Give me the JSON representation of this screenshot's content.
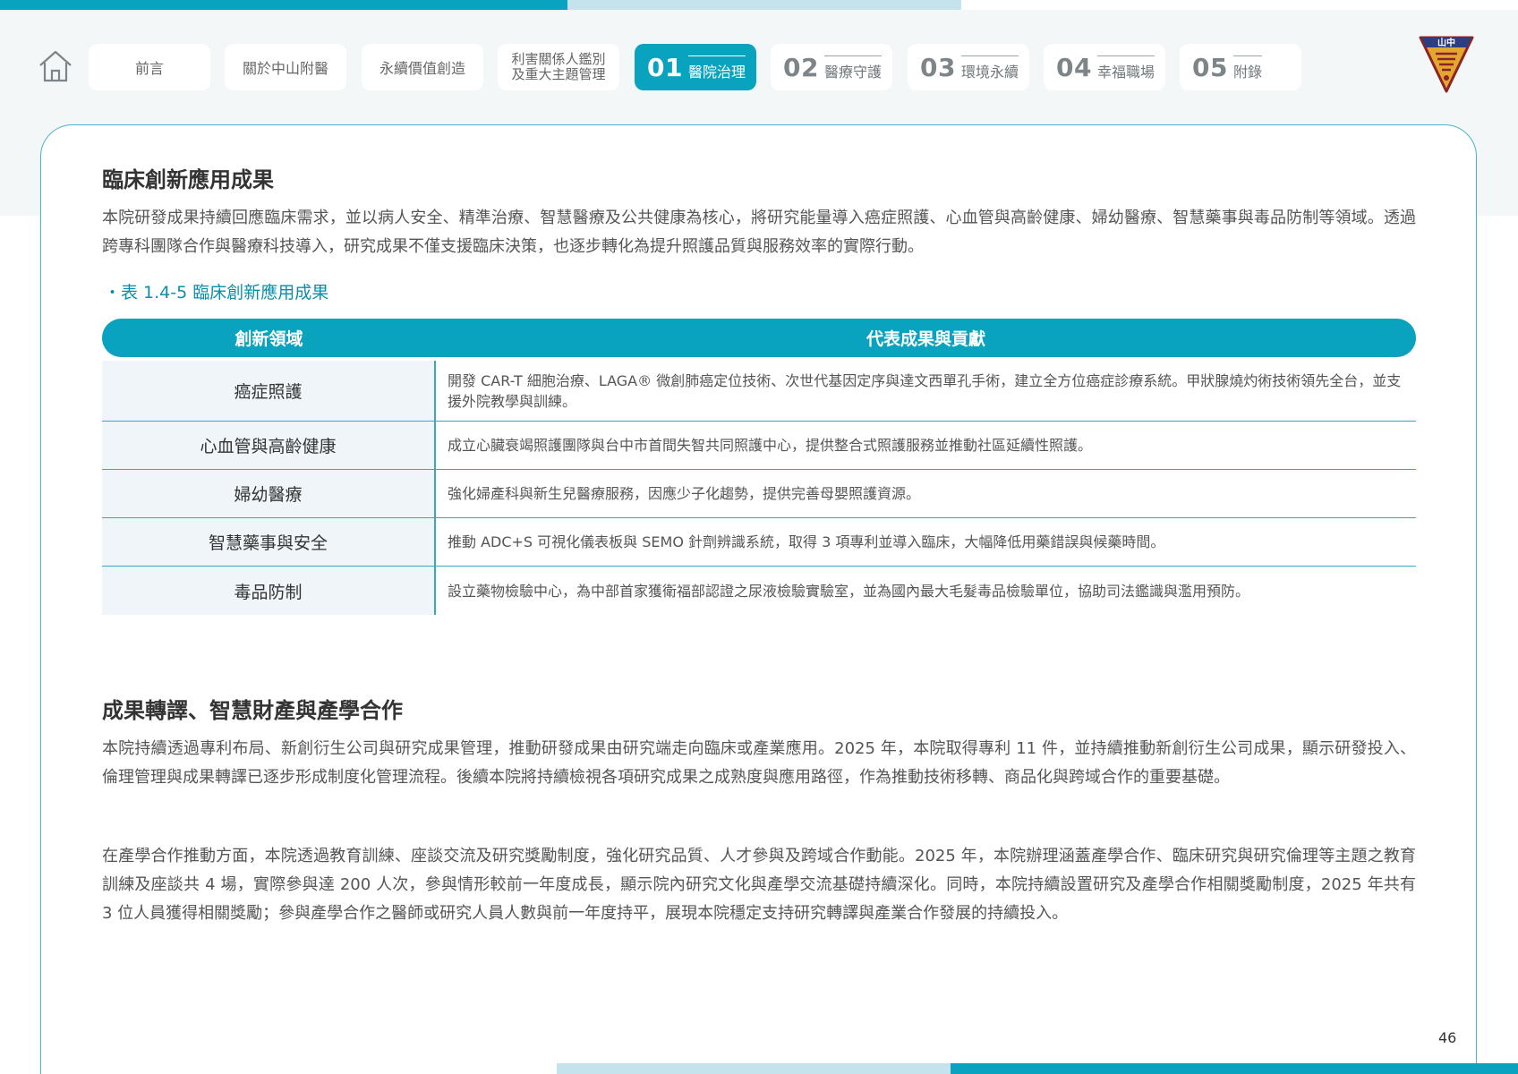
{
  "nav": {
    "tabs": [
      {
        "label": "前言"
      },
      {
        "label": "關於中山附醫"
      },
      {
        "label": "永續價值創造"
      },
      {
        "label_line1": "利害關係人鑑別",
        "label_line2": "及重大主題管理"
      }
    ],
    "chapters": [
      {
        "num": "01",
        "label": "醫院治理",
        "active": true
      },
      {
        "num": "02",
        "label": "醫療守護"
      },
      {
        "num": "03",
        "label": "環境永續"
      },
      {
        "num": "04",
        "label": "幸福職場"
      },
      {
        "num": "05",
        "label": "附錄"
      }
    ],
    "logo_text": "山中"
  },
  "section1": {
    "title": "臨床創新應用成果",
    "paragraph": "本院研發成果持續回應臨床需求，並以病人安全、精準治療、智慧醫療及公共健康為核心，將研究能量導入癌症照護、心血管與高齡健康、婦幼醫療、智慧藥事與毒品防制等領域。透過跨專科團隊合作與醫療科技導入，研究成果不僅支援臨床決策，也逐步轉化為提升照護品質與服務效率的實際行動。"
  },
  "table": {
    "caption": "・表 1.4-5 臨床創新應用成果",
    "headers": [
      "創新領域",
      "代表成果與貢獻"
    ],
    "rows": [
      {
        "field": "癌症照護",
        "result": "開發 CAR-T 細胞治療、LAGA® 微創肺癌定位技術、次世代基因定序與達文西單孔手術，建立全方位癌症診療系統。甲狀腺燒灼術技術領先全台，並支援外院教學與訓練。"
      },
      {
        "field": "心血管與高齡健康",
        "result": "成立心臟衰竭照護團隊與台中市首間失智共同照護中心，提供整合式照護服務並推動社區延續性照護。"
      },
      {
        "field": "婦幼醫療",
        "result": "強化婦產科與新生兒醫療服務，因應少子化趨勢，提供完善母嬰照護資源。"
      },
      {
        "field": "智慧藥事與安全",
        "result": "推動 ADC+S 可視化儀表板與 SEMO 針劑辨識系統，取得 3 項專利並導入臨床，大幅降低用藥錯誤與候藥時間。"
      },
      {
        "field": "毒品防制",
        "result": "設立藥物檢驗中心，為中部首家獲衛福部認證之尿液檢驗實驗室，並為國內最大毛髮毒品檢驗單位，協助司法鑑識與濫用預防。"
      }
    ]
  },
  "section2": {
    "title": "成果轉譯、智慧財產與產學合作",
    "paragraph1": "本院持續透過專利布局、新創衍生公司與研究成果管理，推動研發成果由研究端走向臨床或產業應用。2025 年，本院取得專利 11 件，並持續推動新創衍生公司成果，顯示研發投入、倫理管理與成果轉譯已逐步形成制度化管理流程。後續本院將持續檢視各項研究成果之成熟度與應用路徑，作為推動技術移轉、商品化與跨域合作的重要基礎。",
    "paragraph2": "在產學合作推動方面，本院透過教育訓練、座談交流及研究獎勵制度，強化研究品質、人才參與及跨域合作動能。2025 年，本院辦理涵蓋產學合作、臨床研究與研究倫理等主題之教育訓練及座談共 4 場，實際參與達 200 人次，參與情形較前一年度成長，顯示院內研究文化與產學交流基礎持續深化。同時，本院持續設置研究及產學合作相關獎勵制度，2025 年共有 3 位人員獲得相關獎勵；參與產學合作之醫師或研究人員人數與前一年度持平，展現本院穩定支持研究轉譯與產業合作發展的持續投入。"
  },
  "footer": {
    "page_number": "46"
  }
}
